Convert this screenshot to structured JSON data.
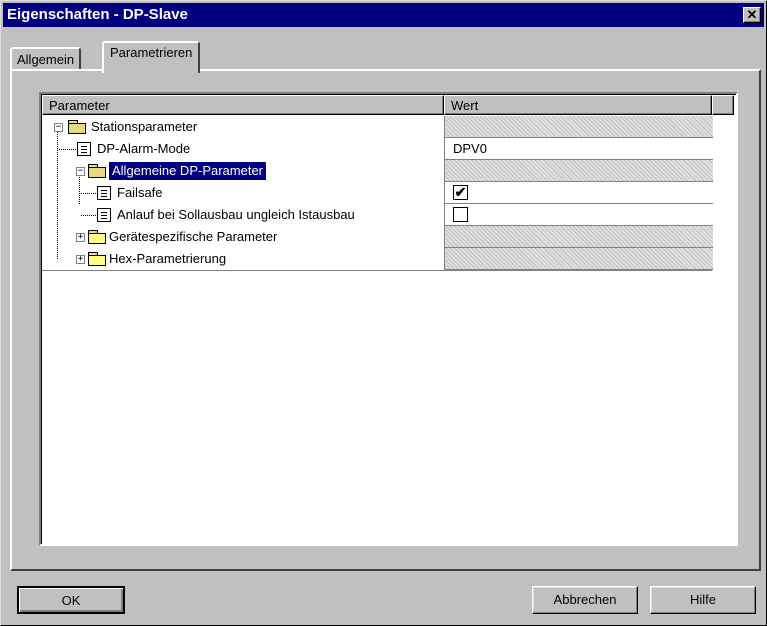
{
  "window": {
    "title": "Eigenschaften - DP-Slave",
    "close_label": "✕"
  },
  "tabs": [
    {
      "label": "Allgemein",
      "active": false
    },
    {
      "label": "Parametrieren",
      "active": true
    }
  ],
  "table": {
    "columns": [
      "Parameter",
      "Wert"
    ],
    "rows": [
      {
        "label": "Stationsparameter",
        "value": "",
        "icon": "folder-open-icon",
        "expander": "minus"
      },
      {
        "label": "DP-Alarm-Mode",
        "value": "DPV0",
        "icon": "document-icon"
      },
      {
        "label": "Allgemeine DP-Parameter",
        "value": "",
        "icon": "folder-open-icon",
        "expander": "minus",
        "selected": true
      },
      {
        "label": "Failsafe",
        "value": "",
        "icon": "document-icon",
        "checkbox": true,
        "checked": true
      },
      {
        "label": "Anlauf bei Sollausbau ungleich Istausbau",
        "value": "",
        "icon": "document-icon",
        "checkbox": true,
        "checked": false
      },
      {
        "label": "Gerätespezifische Parameter",
        "value": "",
        "icon": "folder-closed-icon",
        "expander": "plus"
      },
      {
        "label": "Hex-Parametrierung",
        "value": "",
        "icon": "folder-closed-icon",
        "expander": "plus"
      }
    ]
  },
  "buttons": {
    "ok": "OK",
    "cancel": "Abbrechen",
    "help": "Hilfe"
  },
  "check_mark": "✔"
}
